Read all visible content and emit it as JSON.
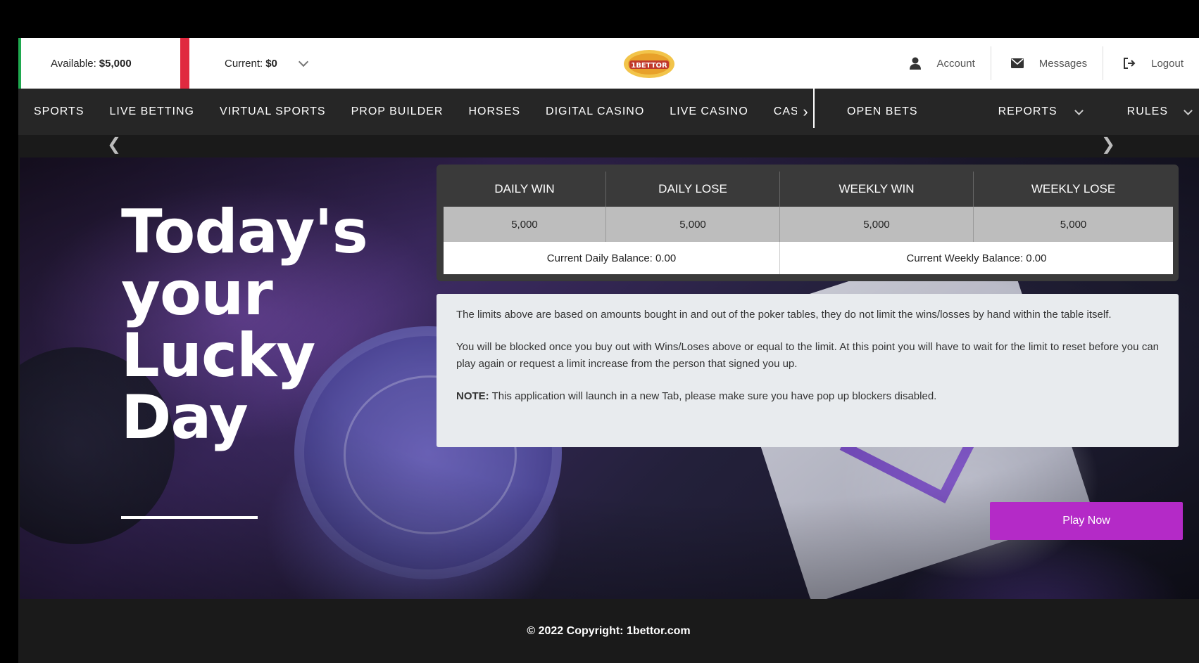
{
  "topbar": {
    "available_label": "Available:",
    "available_value": "$5,000",
    "current_label": "Current:",
    "current_value": "$0",
    "logo_alt": "1BETTOR",
    "account": "Account",
    "messages": "Messages",
    "logout": "Logout"
  },
  "nav": {
    "items": [
      "SPORTS",
      "LIVE BETTING",
      "VIRTUAL SPORTS",
      "PROP BUILDER",
      "HORSES",
      "DIGITAL CASINO",
      "LIVE CASINO",
      "CASINO"
    ],
    "open_bets": "OPEN BETS",
    "reports": "REPORTS",
    "rules": "RULES"
  },
  "hero": {
    "headline": "Today's your Lucky Day"
  },
  "limits": {
    "headers": [
      "DAILY WIN",
      "DAILY LOSE",
      "WEEKLY WIN",
      "WEEKLY LOSE"
    ],
    "values": [
      "5,000",
      "5,000",
      "5,000",
      "5,000"
    ],
    "daily_balance": "Current Daily Balance: 0.00",
    "weekly_balance": "Current Weekly Balance: 0.00"
  },
  "notes": {
    "p1": "The limits above are based on amounts bought in and out of the poker tables, they do not limit the wins/losses by hand within the table itself.",
    "p2": "You will be blocked once you buy out with Wins/Loses above or equal to the limit. At this point you will have to wait for the limit to reset before you can play again or request a limit increase from the person that signed you up.",
    "note_label": "NOTE:",
    "note_text": " This application will launch in a new Tab, please make sure you have pop up blockers disabled."
  },
  "play_button": "Play Now",
  "footer": "© 2022 Copyright: 1bettor.com",
  "colors": {
    "available_accent": "#1fa84f",
    "current_accent": "#e0293f",
    "play_button": "#b42ac7"
  }
}
